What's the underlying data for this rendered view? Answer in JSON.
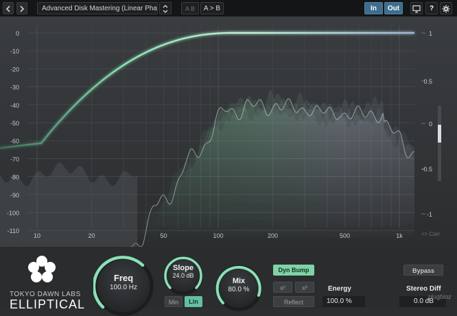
{
  "toolbar": {
    "undo_icon": "arrow-left-icon",
    "redo_icon": "arrow-right-icon",
    "preset_name": "Advanced Disk Mastering (Linear Phase)",
    "ab_label": "A B",
    "ab_copy_label": "A > B",
    "in_label": "In",
    "out_label": "Out",
    "display_icon": "monitor-icon",
    "help_label": "?",
    "settings_icon": "gear-icon"
  },
  "graph": {
    "db_ticks": [
      "0",
      "-10",
      "-20",
      "-30",
      "-40",
      "-50",
      "-60",
      "-70",
      "-80",
      "-90",
      "-100",
      "-110"
    ],
    "freq_ticks": [
      "10",
      "20",
      "50",
      "100",
      "200",
      "500",
      "1k"
    ],
    "corr_ticks": [
      "1",
      "0.5",
      "0",
      "-0.5",
      "-1"
    ],
    "corr_label": "<> Corr.",
    "curve_color": "#86e3b4",
    "spectrum_color": "#9ee6c0"
  },
  "controls": {
    "freq_label": "Freq",
    "freq_value": "100.0 Hz",
    "slope_label": "Slope",
    "slope_value": "24.0 dB",
    "min_label": "Min",
    "lin_label": "Lin",
    "mix_label": "Mix",
    "mix_value": "80.0 %",
    "dyn_bump_label": "Dyn Bump",
    "x2_label": "x²",
    "x3_label": "x³",
    "reflect_label": "Reflect",
    "energy_label": "Energy",
    "energy_value": "100.0 %",
    "bypass_label": "Bypass",
    "stereo_diff_label": "Stereo Diff",
    "stereo_diff_value": "0.0 dB",
    "watermark": "plugbioz"
  },
  "brand": {
    "company": "TOKYO DAWN LABS",
    "product": "ELLIPTICAL",
    "logo_icon": "flower-logo-icon"
  }
}
